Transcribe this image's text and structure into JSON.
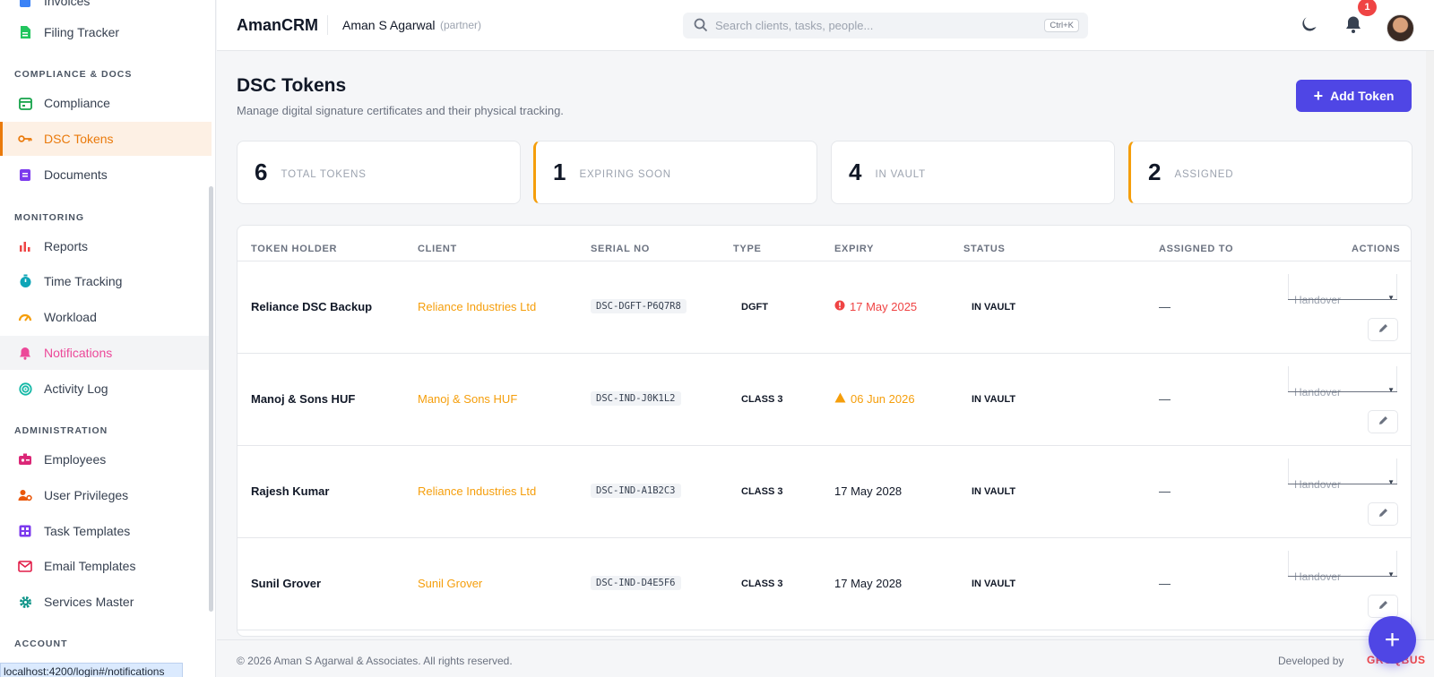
{
  "sidebar": {
    "items_top": [
      {
        "label": "Invoices"
      },
      {
        "label": "Filing Tracker"
      }
    ],
    "sections": [
      {
        "title": "COMPLIANCE & DOCS",
        "items": [
          {
            "label": "Compliance"
          },
          {
            "label": "DSC Tokens"
          },
          {
            "label": "Documents"
          }
        ]
      },
      {
        "title": "MONITORING",
        "items": [
          {
            "label": "Reports"
          },
          {
            "label": "Time Tracking"
          },
          {
            "label": "Workload"
          },
          {
            "label": "Notifications"
          },
          {
            "label": "Activity Log"
          }
        ]
      },
      {
        "title": "ADMINISTRATION",
        "items": [
          {
            "label": "Employees"
          },
          {
            "label": "User Privileges"
          },
          {
            "label": "Task Templates"
          },
          {
            "label": "Email Templates"
          },
          {
            "label": "Services Master"
          }
        ]
      },
      {
        "title": "ACCOUNT",
        "items": []
      }
    ],
    "status_url": "localhost:4200/login#/notifications"
  },
  "header": {
    "brand": "AmanCRM",
    "user_name": "Aman S Agarwal",
    "user_role": "(partner)",
    "search_placeholder": "Search clients, tasks, people...",
    "search_shortcut": "Ctrl+K",
    "notification_count": "1"
  },
  "page": {
    "title": "DSC Tokens",
    "subtitle": "Manage digital signature certificates and their physical tracking.",
    "add_button": "Add Token"
  },
  "stats": [
    {
      "value": "6",
      "label": "TOTAL TOKENS"
    },
    {
      "value": "1",
      "label": "EXPIRING SOON"
    },
    {
      "value": "4",
      "label": "IN VAULT"
    },
    {
      "value": "2",
      "label": "ASSIGNED"
    }
  ],
  "table": {
    "columns": [
      "TOKEN HOLDER",
      "CLIENT",
      "SERIAL NO",
      "TYPE",
      "EXPIRY",
      "STATUS",
      "ASSIGNED TO",
      "ACTIONS"
    ],
    "rows": [
      {
        "holder": "Reliance DSC Backup",
        "client": "Reliance Industries Ltd",
        "serial": "DSC-DGFT-P6Q7R8",
        "type": "DGFT",
        "expiry": "17 May 2025",
        "expiry_state": "expired",
        "status": "IN VAULT",
        "assigned": "—",
        "action": "Handover"
      },
      {
        "holder": "Manoj & Sons HUF",
        "client": "Manoj & Sons HUF",
        "serial": "DSC-IND-J0K1L2",
        "type": "CLASS 3",
        "expiry": "06 Jun 2026",
        "expiry_state": "warning",
        "status": "IN VAULT",
        "assigned": "—",
        "action": "Handover"
      },
      {
        "holder": "Rajesh Kumar",
        "client": "Reliance Industries Ltd",
        "serial": "DSC-IND-A1B2C3",
        "type": "CLASS 3",
        "expiry": "17 May 2028",
        "expiry_state": "ok",
        "status": "IN VAULT",
        "assigned": "—",
        "action": "Handover"
      },
      {
        "holder": "Sunil Grover",
        "client": "Sunil Grover",
        "serial": "DSC-IND-D4E5F6",
        "type": "CLASS 3",
        "expiry": "17 May 2028",
        "expiry_state": "ok",
        "status": "IN VAULT",
        "assigned": "—",
        "action": "Handover"
      }
    ]
  },
  "footer": {
    "copyright": "© 2026 Aman S Agarwal & Associates. All rights reserved.",
    "developed_by": "Developed by",
    "developer": "GROQBUS"
  },
  "colors": {
    "accent": "#4f46e5",
    "active_nav": "#ea7a0b",
    "client_link": "#f59e0b",
    "expired": "#ef4444"
  }
}
